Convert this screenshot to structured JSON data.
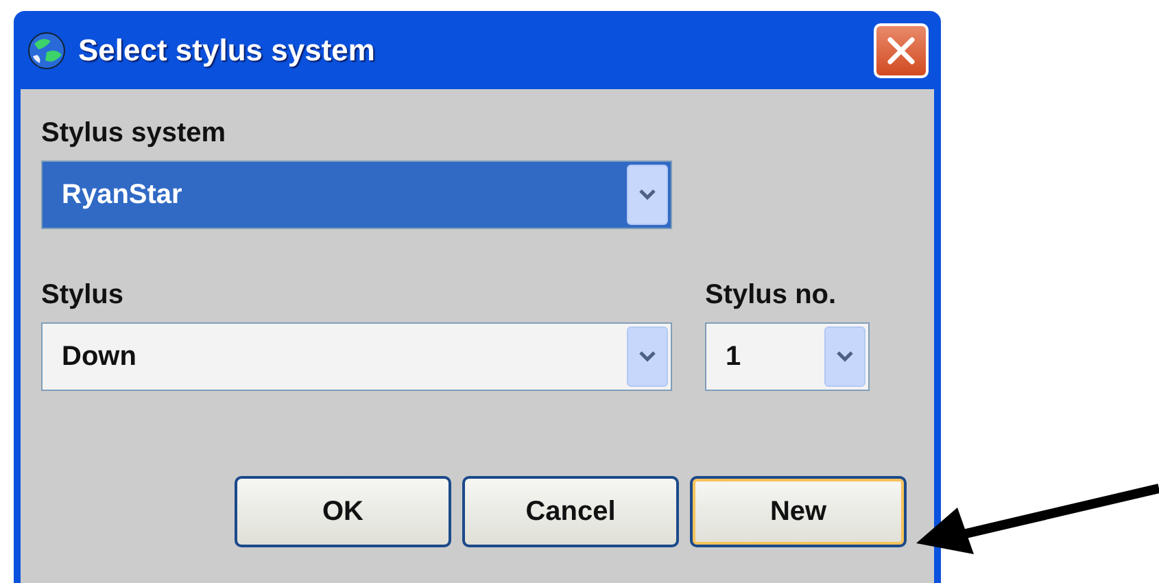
{
  "window": {
    "title": "Select stylus system"
  },
  "field_rows": [
    [
      {
        "label": "Stylus system",
        "value": "RyanStar",
        "focused": true
      }
    ],
    [
      {
        "label": "Stylus",
        "value": "Down",
        "focused": false
      },
      {
        "label": "Stylus no.",
        "value": "1",
        "focused": false
      }
    ]
  ],
  "buttons": [
    {
      "label": "OK",
      "focused": false
    },
    {
      "label": "Cancel",
      "focused": false
    },
    {
      "label": "New",
      "focused": true
    }
  ]
}
